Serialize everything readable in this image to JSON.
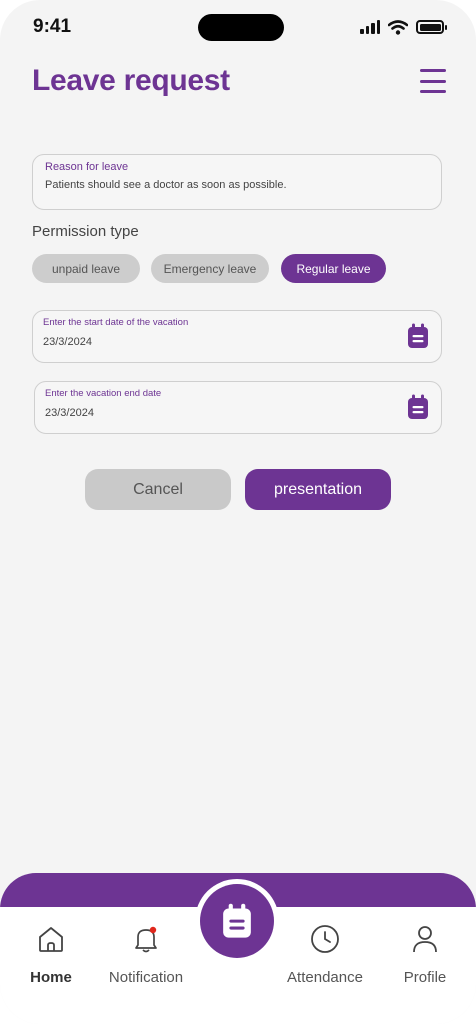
{
  "status_bar": {
    "time": "9:41"
  },
  "header": {
    "title": "Leave request",
    "menu_icon": "hamburger-menu-icon"
  },
  "reason": {
    "label": "Reason for leave",
    "value": "Patients should see a doctor as soon as possible."
  },
  "permission": {
    "label": "Permission type",
    "options": [
      "unpaid leave",
      "Emergency leave",
      "Regular leave"
    ],
    "selected": "Regular leave"
  },
  "start_date": {
    "label": "Enter the start date of the vacation",
    "value": "23/3/2024"
  },
  "end_date": {
    "label": "Enter the vacation end date",
    "value": "23/3/2024"
  },
  "actions": {
    "cancel": "Cancel",
    "submit": "presentation"
  },
  "nav": {
    "items": [
      {
        "label": "Home",
        "icon": "home-icon",
        "active": true
      },
      {
        "label": "Notification",
        "icon": "bell-icon",
        "badge": true
      },
      {
        "label": "",
        "icon": "calendar-icon"
      },
      {
        "label": "Attendance",
        "icon": "clock-icon"
      },
      {
        "label": "Profile",
        "icon": "user-icon"
      }
    ]
  },
  "colors": {
    "accent": "#6d3493",
    "background": "#f4f4f4",
    "chip_inactive": "#cdcdcd",
    "badge": "#e0271c"
  }
}
